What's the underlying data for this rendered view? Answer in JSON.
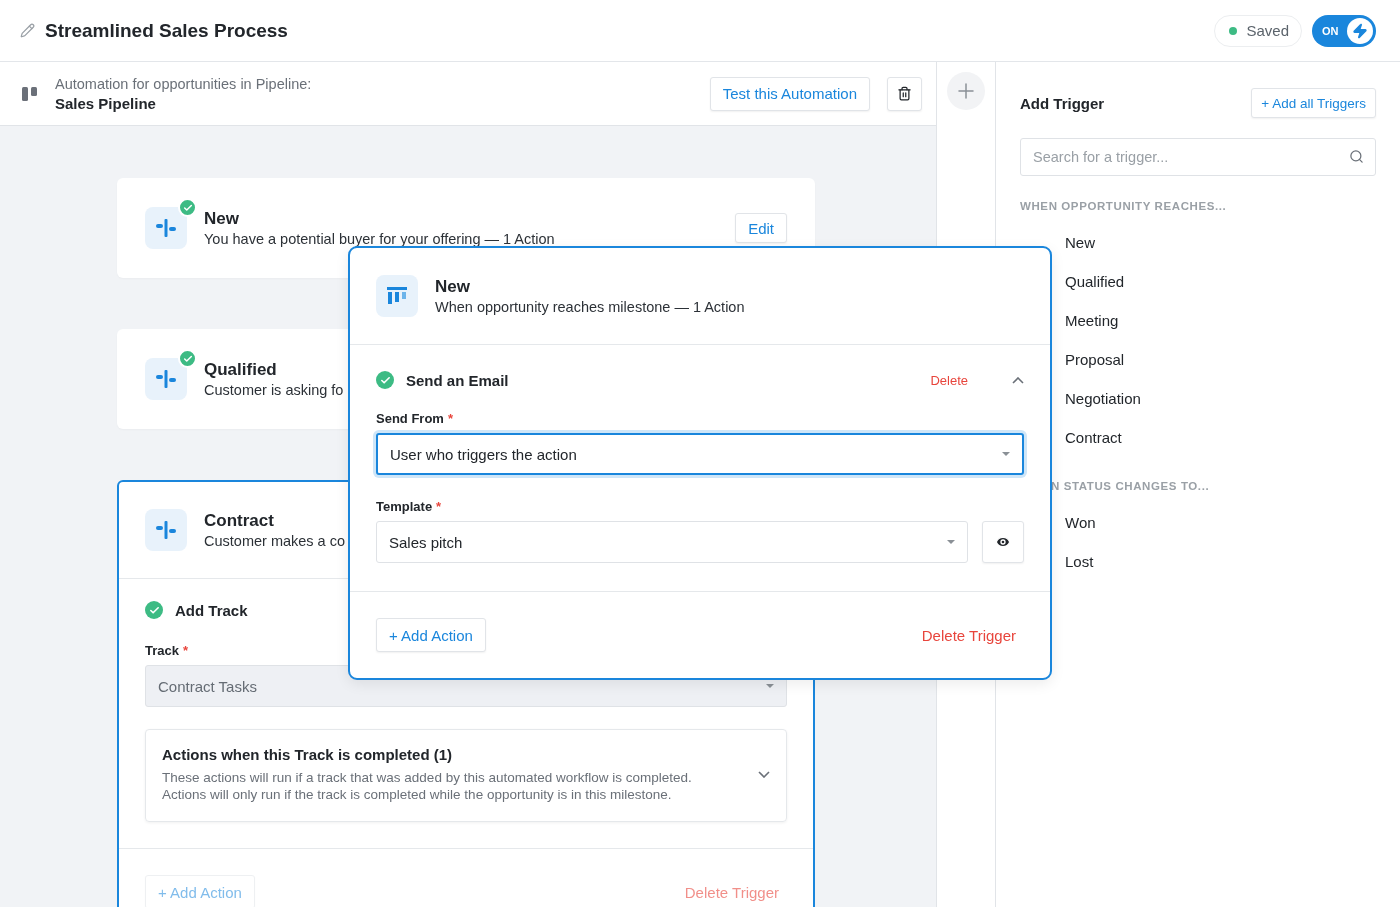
{
  "header": {
    "title": "Streamlined Sales Process",
    "status": {
      "label": "Saved",
      "color": "#3dbb84"
    },
    "toggle": {
      "label": "ON",
      "on": true
    }
  },
  "pipeline_bar": {
    "caption": "Automation for opportunities in Pipeline:",
    "pipeline": "Sales Pipeline",
    "test_button": "Test this Automation"
  },
  "triggers": [
    {
      "title": "New",
      "description": "You have a potential buyer for your offering — 1 Action",
      "completed": true,
      "selected": false,
      "edit_button": "Edit"
    },
    {
      "title": "Qualified",
      "description": "Customer is asking fo",
      "completed": true,
      "selected": false
    },
    {
      "title": "Contract",
      "description": "Customer makes a co",
      "completed": false,
      "selected": true,
      "action": {
        "title": "Add Track",
        "completed": true,
        "field": {
          "label": "Track",
          "required_mark": "*",
          "value": "Contract Tasks",
          "disabled": true
        },
        "accordion": {
          "title": "Actions when this Track is completed (1)",
          "description": "These actions will run if a track that was added by this automated workflow is completed. Actions will only run if the track is completed while the opportunity is in this milestone.",
          "expanded": false
        }
      },
      "add_action": "+ Add Action",
      "delete_trigger": "Delete Trigger"
    }
  ],
  "dragged_trigger": {
    "title": "New",
    "subtitle": "When opportunity reaches milestone — 1 Action",
    "action": {
      "title": "Send an Email",
      "completed": true,
      "delete": "Delete",
      "expanded": true,
      "fields": [
        {
          "label": "Send From",
          "required_mark": "*",
          "value": "User who triggers the action",
          "focused": true,
          "preview": false
        },
        {
          "label": "Template",
          "required_mark": "*",
          "value": "Sales pitch",
          "focused": false,
          "preview": true
        }
      ]
    },
    "add_action": "+ Add Action",
    "delete_trigger": "Delete Trigger"
  },
  "trigger_panel": {
    "title": "Add Trigger",
    "add_all": "+ Add all Triggers",
    "search": {
      "placeholder": "Search for a trigger..."
    },
    "groups": [
      {
        "heading": "WHEN OPPORTUNITY REACHES...",
        "items": [
          "New",
          "Qualified",
          "Meeting",
          "Proposal",
          "Negotiation",
          "Contract"
        ]
      },
      {
        "heading": "N STATUS CHANGES TO...",
        "items": [
          "Won",
          "Lost"
        ]
      }
    ]
  }
}
